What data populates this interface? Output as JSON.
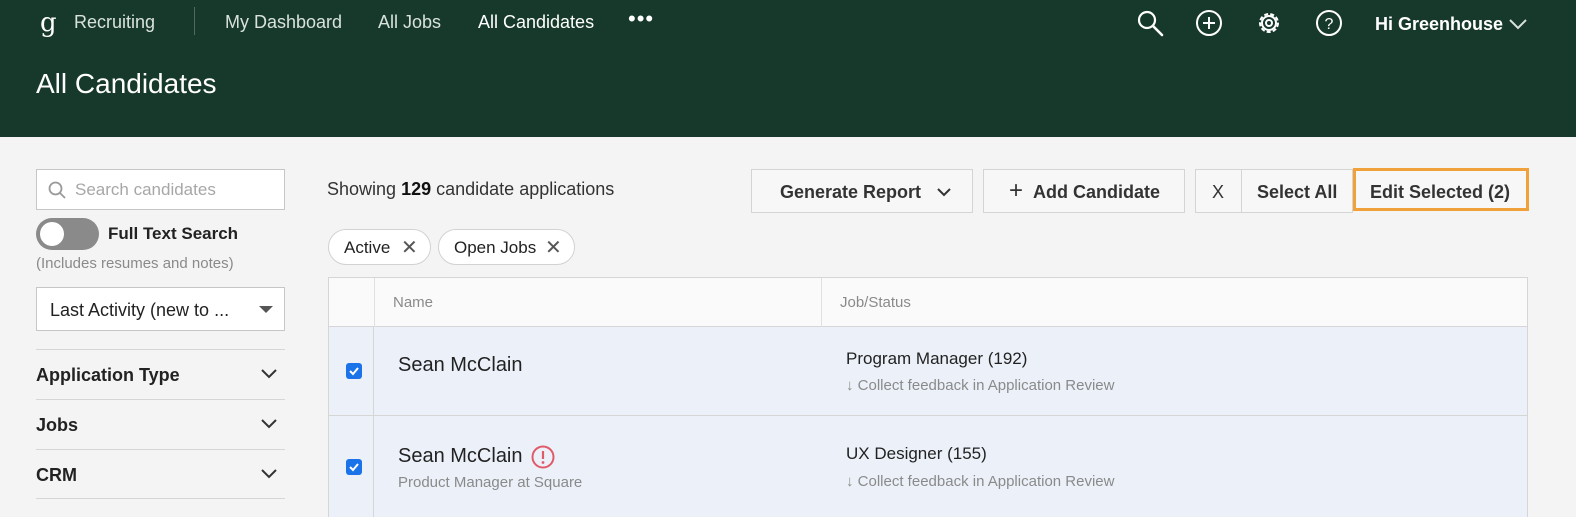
{
  "header": {
    "logo_glyph": "g",
    "app_name": "Recruiting",
    "nav": [
      "My Dashboard",
      "All Jobs",
      "All Candidates"
    ],
    "more": "•••",
    "icons": [
      "search-icon",
      "add-circle-icon",
      "gear-icon",
      "help-icon"
    ],
    "user_greeting": "Hi Greenhouse",
    "page_title": "All Candidates"
  },
  "sidebar": {
    "search_placeholder": "Search candidates",
    "full_text_label": "Full Text Search",
    "full_text_hint": "(Includes resumes and notes)",
    "sort_value": "Last Activity (new to ...",
    "filters": [
      "Application Type",
      "Jobs",
      "CRM"
    ]
  },
  "toolbar": {
    "showing_prefix": "Showing",
    "showing_count": "129",
    "showing_suffix": "candidate applications",
    "generate_report": "Generate Report",
    "add_candidate": "Add Candidate",
    "clear": "X",
    "select_all": "Select All",
    "edit_selected": "Edit Selected (2)"
  },
  "chips": [
    "Active",
    "Open Jobs"
  ],
  "table": {
    "headers": [
      "Name",
      "Job/Status"
    ],
    "rows": [
      {
        "name": "Sean McClain",
        "subtitle": "",
        "job": "Program Manager (192)",
        "status": "↓ Collect feedback in Application Review",
        "checked": true,
        "warning": false
      },
      {
        "name": "Sean McClain",
        "subtitle": "Product Manager at Square",
        "job": "UX Designer (155)",
        "status": "↓ Collect feedback in Application Review",
        "checked": true,
        "warning": true
      }
    ]
  },
  "colors": {
    "header_bg": "#16392b",
    "highlight": "#f0a13a",
    "checkbox": "#1a73e8",
    "row_selected": "#ecf1f9",
    "warning": "#e05a6a"
  }
}
